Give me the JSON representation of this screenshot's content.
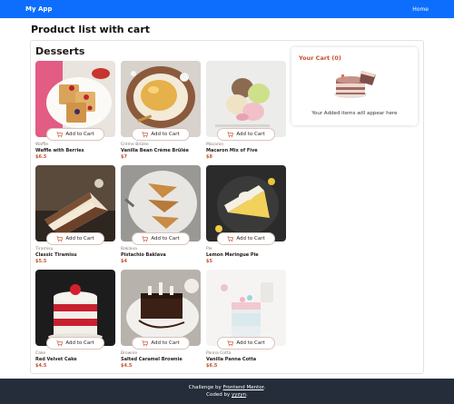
{
  "navbar": {
    "brand": "My App",
    "home_label": "Home"
  },
  "page": {
    "title": "Product list with cart"
  },
  "section": {
    "title": "Desserts"
  },
  "product_button_label": "Add to Cart",
  "products": [
    {
      "category": "Waffle",
      "name": "Waffle with Berries",
      "price": "$6.5"
    },
    {
      "category": "Crème Brûlée",
      "name": "Vanilla Bean Crème Brûlée",
      "price": "$7"
    },
    {
      "category": "Macaron",
      "name": "Macaron Mix of Five",
      "price": "$8"
    },
    {
      "category": "Tiramisu",
      "name": "Classic Tiramisu",
      "price": "$5.5"
    },
    {
      "category": "Baklava",
      "name": "Pistachio Baklava",
      "price": "$4"
    },
    {
      "category": "Pie",
      "name": "Lemon Meringue Pie",
      "price": "$5"
    },
    {
      "category": "Cake",
      "name": "Red Velvet Cake",
      "price": "$4.5"
    },
    {
      "category": "Brownie",
      "name": "Salted Caramel Brownie",
      "price": "$4.5"
    },
    {
      "category": "Panna Cotta",
      "name": "Vanilla Panna Cotta",
      "price": "$6.5"
    }
  ],
  "cart": {
    "title": "Your Cart (0)",
    "empty_message": "Your Added items will appear here"
  },
  "footer": {
    "line1_prefix": "Challenge by ",
    "line1_link": "Frontend Mentor",
    "line1_suffix": ".",
    "line2_prefix": "Coded by ",
    "line2_link": "yyzyn",
    "line2_suffix": "."
  },
  "colors": {
    "nav": "#0d6efd",
    "accent": "#c7502e",
    "footer": "#252d3a"
  }
}
